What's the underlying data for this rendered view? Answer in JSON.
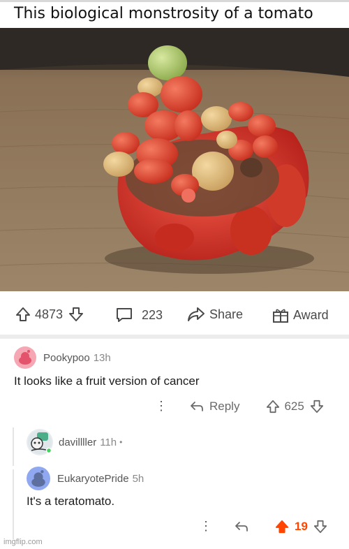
{
  "post": {
    "title": "This biological monstrosity of a tomato"
  },
  "action_bar": {
    "upvotes": "4873",
    "comments": "223",
    "share_label": "Share",
    "award_label": "Award"
  },
  "comments": [
    {
      "username": "Pookypoo",
      "time": "13h",
      "body": "It looks like a fruit version of cancer",
      "reply_label": "Reply",
      "score": "625",
      "avatar_color": "#f5a7b3"
    },
    {
      "username": "davillller",
      "time": "11h",
      "separator": "•"
    },
    {
      "username": "EukaryotePride",
      "time": "5h",
      "body": "It's a teratomato.",
      "score": "19",
      "avatar_color": "#8fa8f0",
      "upvote_color": "#ff4500"
    }
  ],
  "watermark": "imgflip.com",
  "colors": {
    "icon_gray": "#4a4a4a",
    "upvoted_orange": "#ff4500",
    "tomato_red": "#d8342c",
    "table_wood": "#8b7358"
  }
}
